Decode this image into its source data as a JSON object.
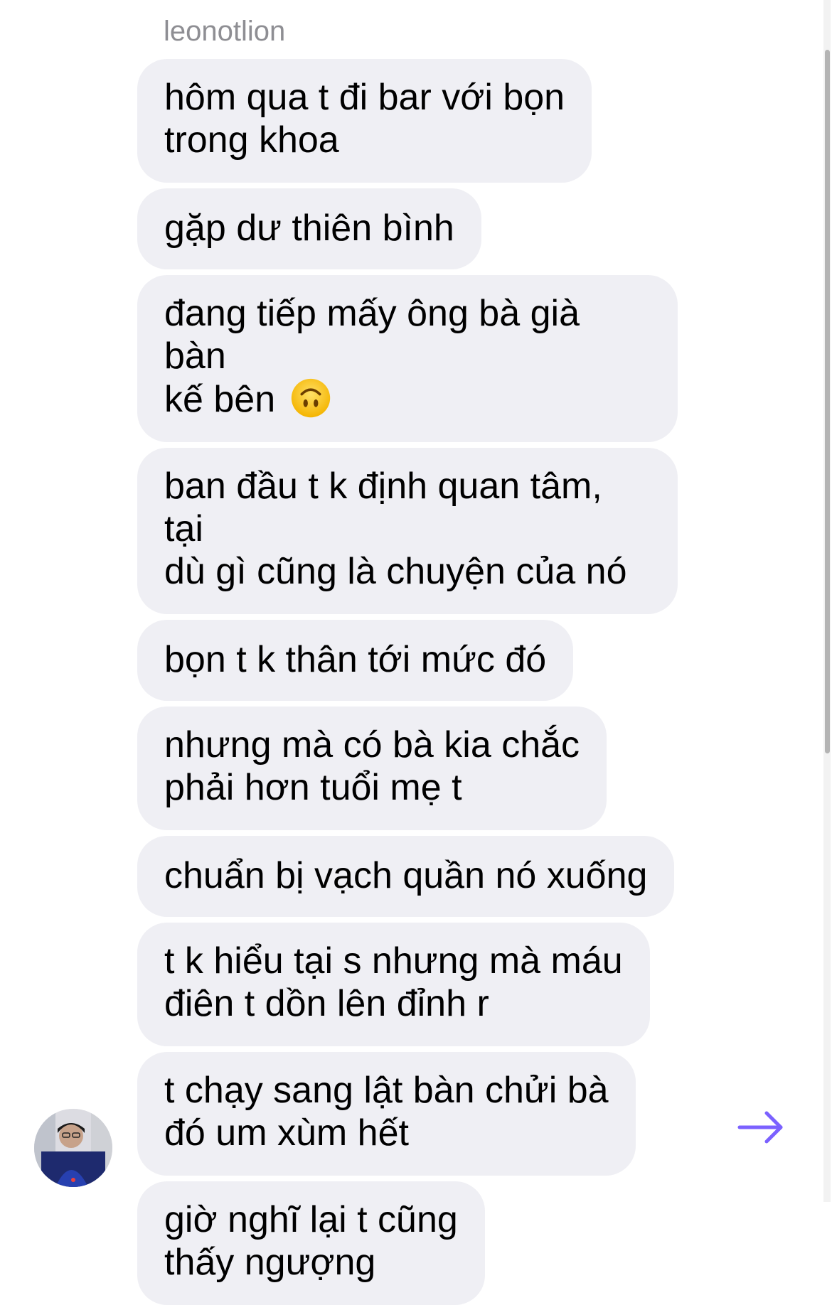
{
  "conversation": {
    "sender_name": "leonotlion",
    "messages": [
      {
        "lines": [
          "hôm qua t đi bar với bọn",
          "trong khoa"
        ]
      },
      {
        "lines": [
          "gặp dư thiên bình"
        ]
      },
      {
        "lines": [
          "đang tiếp mấy ông bà già bàn",
          "kế bên"
        ],
        "emoji": "upside-down-face-emoji"
      },
      {
        "lines": [
          "ban đầu t k định quan tâm, tại",
          "dù gì cũng là chuyện của nó"
        ]
      },
      {
        "lines": [
          "bọn t k thân tới mức đó"
        ]
      },
      {
        "lines": [
          "nhưng mà có bà kia chắc",
          "phải hơn tuổi mẹ t"
        ]
      },
      {
        "lines": [
          "chuẩn bị vạch quần nó xuống"
        ]
      },
      {
        "lines": [
          "t k hiểu tại s nhưng mà máu",
          "điên t dồn lên đỉnh r"
        ]
      },
      {
        "lines": [
          "t chạy sang lật bàn chửi bà",
          "đó um xùm hết"
        ]
      },
      {
        "lines": [
          "giờ nghĩ lại t cũng",
          "thấy ngượng"
        ]
      }
    ]
  },
  "icons": {
    "avatar": "avatar",
    "send": "arrow-right-icon",
    "emoji": "upside-down-face-emoji"
  },
  "colors": {
    "bubble_bg": "#efeff4",
    "sender_text": "#8e8e93",
    "accent": "#7b61ff"
  }
}
